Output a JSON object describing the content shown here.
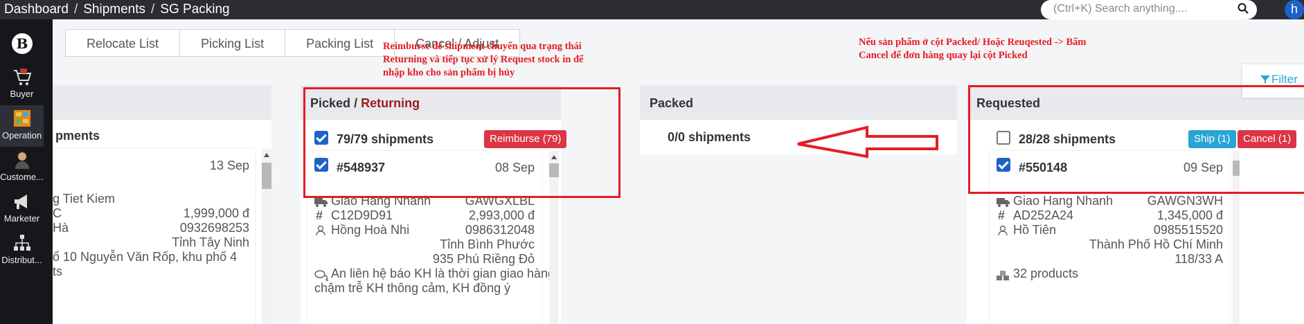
{
  "breadcrumb": [
    "Dashboard",
    "Shipments",
    "SG Packing"
  ],
  "breadcrumb_sep": "/",
  "search_placeholder": "(Ctrl+K) Search anything....",
  "user_initial": "h",
  "sidebar": {
    "logo_letter": "B",
    "items": [
      {
        "label": "Buyer",
        "icon": "cart-icon"
      },
      {
        "label": "Operation",
        "icon": "shelves-icon"
      },
      {
        "label": "Custome...",
        "icon": "customer-icon"
      },
      {
        "label": "Marketer",
        "icon": "megaphone-icon"
      },
      {
        "label": "Distribut...",
        "icon": "distribution-icon"
      }
    ]
  },
  "tabs": [
    "Relocate List",
    "Picking List",
    "Packing List",
    "Cancel / Adjust"
  ],
  "filter_label": "Filter",
  "columns": {
    "left": {
      "summary": "pments",
      "date": "13 Sep",
      "carrier": "g Tiet Kiem",
      "code": "C",
      "amount": "1,999,000 đ",
      "name": "Hà",
      "phone": "0932698253",
      "province": "Tỉnh Tây Ninh",
      "address1": "ố 10 Nguyễn Văn Rốp, khu phố 4",
      "address2": "ts"
    },
    "picked": {
      "title": "Picked",
      "title_sep": "/",
      "title_returning": "Returning",
      "summary": "79/79 shipments",
      "reimburse_button": "Reimburse (79)",
      "card_id": "#548937",
      "card_date": "08 Sep",
      "carrier": "Giao Hang Nhanh",
      "tracking": "GAWGXLBL",
      "code": "C12D9D91",
      "amount": "2,993,000 đ",
      "name": "Hồng Hoà Nhi",
      "phone": "0986312048",
      "province": "Tỉnh Bình Phước",
      "address": "935 Phú Riềng Đỏ",
      "note1": "An liên hệ báo KH là thời gian giao hàng",
      "note2": "chậm trễ KH thông cảm, KH đồng ý"
    },
    "packed": {
      "title": "Packed",
      "summary": "0/0 shipments"
    },
    "requested": {
      "title": "Requested",
      "summary": "28/28 shipments",
      "ship_button": "Ship (1)",
      "cancel_button": "Cancel (1)",
      "card_id": "#550148",
      "card_date": "09 Sep",
      "carrier": "Giao Hang Nhanh",
      "tracking": "GAWGN3WH",
      "code": "AD252A24",
      "amount": "1,345,000 đ",
      "name": "Hồ Tiên",
      "phone": "0985515520",
      "province": "Thành Phố Hồ Chí Minh",
      "address": "118/33 A",
      "products": "32 products"
    }
  },
  "annotations": {
    "note_left": [
      "Reimburse để shipment chuyển qua trạng thái",
      "Returning và tiếp tục xử lý Request stock in để",
      "nhập kho cho sản phẩm bị hủy"
    ],
    "note_right": [
      "Nếu sản phẩm ở cột Packed/ Hoặc Reuqested -> Bấm",
      "Cancel để đơn hàng quay lại cột Picked"
    ],
    "color": "#e41c23"
  },
  "colors": {
    "topbar": "#2b2d33",
    "sidebar": "#16171a",
    "primary": "#1e62c8",
    "danger": "#dc3545",
    "info": "#2aa4d5",
    "returning": "#9b1c1c"
  }
}
